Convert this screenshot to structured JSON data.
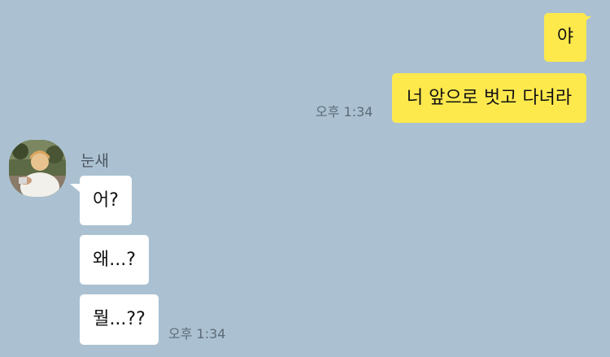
{
  "chat": {
    "outgoing": [
      {
        "text": "야"
      },
      {
        "text": "너 앞으로 벗고 다녀라"
      }
    ],
    "outgoing_time": "오후 1:34",
    "incoming": {
      "sender_name": "눈새",
      "messages": [
        {
          "text": "어?"
        },
        {
          "text": "왜...?"
        },
        {
          "text": "뭘...??"
        }
      ],
      "time": "오후 1:34"
    }
  },
  "colors": {
    "background": "#abc1d1",
    "outgoing_bubble": "#fee94d",
    "incoming_bubble": "#ffffff",
    "timestamp": "#5d6b78"
  },
  "icons": {
    "avatar": "profile-photo"
  }
}
